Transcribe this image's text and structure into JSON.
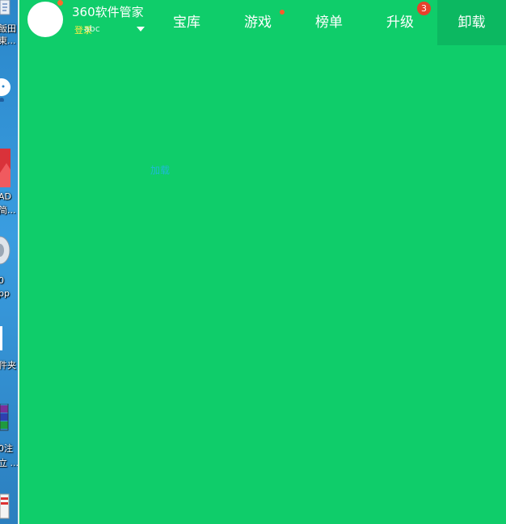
{
  "app": {
    "title": "360软件管家",
    "login": "登录",
    "account_overlay": "abc",
    "accent_color": "#0fcd6a",
    "active_tab_color": "#0cb861"
  },
  "tabs": [
    {
      "label": "宝库"
    },
    {
      "label": "游戏",
      "dot": true
    },
    {
      "label": "榜单"
    },
    {
      "label": "升级",
      "badge": "3"
    },
    {
      "label": "卸载",
      "active": true
    }
  ],
  "main": {
    "status": "加载"
  },
  "desktop": {
    "items": [
      {
        "label_1": "飯田",
        "label_2": "東..."
      },
      {
        "label_1": "AD",
        "label_2": "简..."
      },
      {
        "label_1": "0",
        "label_2": "pp"
      },
      {
        "label_1": "件夹"
      },
      {
        "label_1": "0注",
        "label_2": "立 ..."
      }
    ]
  }
}
